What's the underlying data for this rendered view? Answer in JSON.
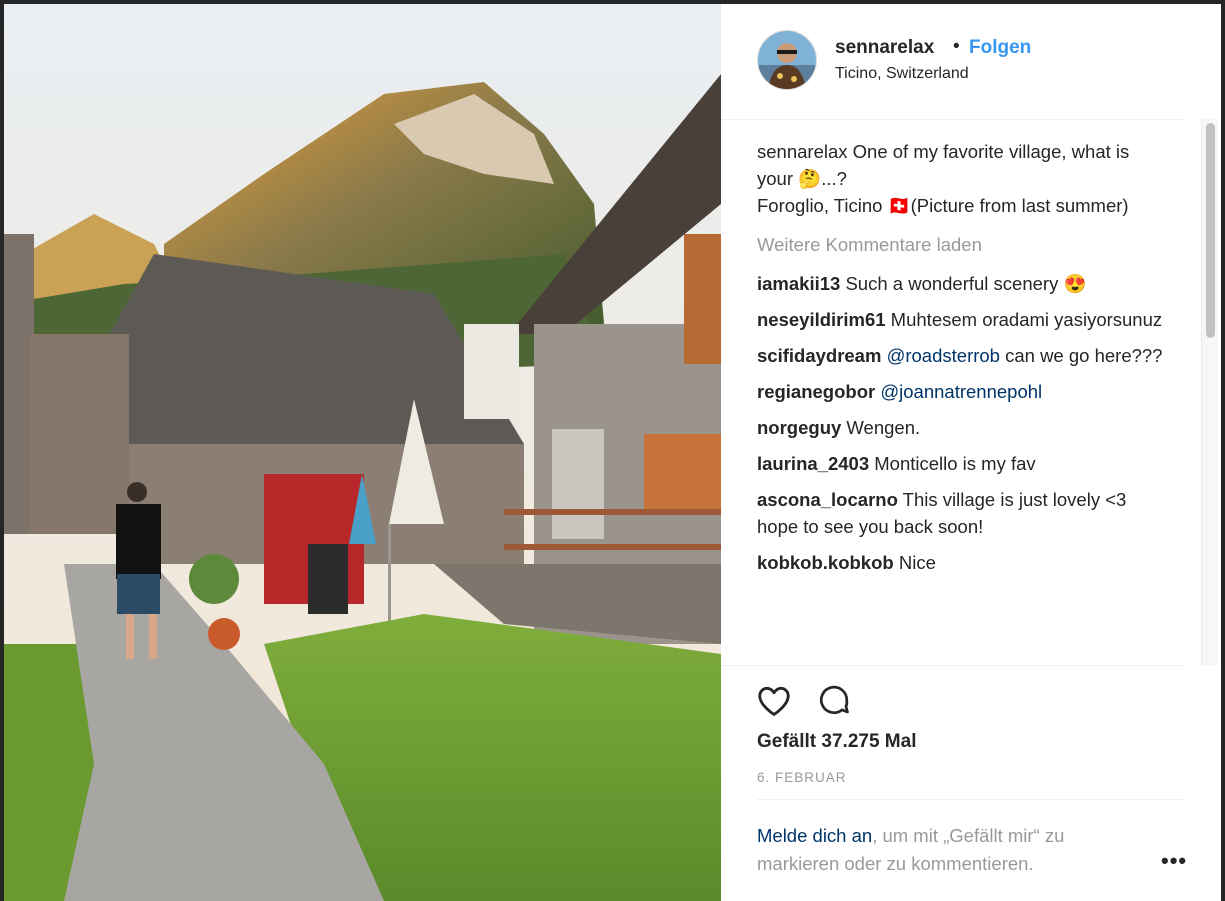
{
  "post": {
    "username": "sennarelax",
    "separator": "•",
    "follow_label": "Folgen",
    "location": "Ticino, Switzerland"
  },
  "caption": {
    "username": "sennarelax",
    "text_part1": " One of my favorite village, what is your ",
    "emoji_think": "🤔",
    "text_part2": "...?",
    "text_part3": "Foroglio, Ticino ",
    "flag": "🇨🇭",
    "text_part4": "(Picture from last summer)"
  },
  "load_more_label": "Weitere Kommentare laden",
  "comments": [
    {
      "user": "iamakii13",
      "text": " Such a wonderful scenery ",
      "emoji": "😍"
    },
    {
      "user": "neseyildirim61",
      "text": " Muhtesem oradami yasiyorsunuz"
    },
    {
      "user": "scifidaydream",
      "mention": "@roadsterrob",
      "text": " can we go here???"
    },
    {
      "user": "regianegobor",
      "mention": "@joannatrennepohl",
      "text": ""
    },
    {
      "user": "norgeguy",
      "text": " Wengen."
    },
    {
      "user": "laurina_2403",
      "text": " Monticello is my fav"
    },
    {
      "user": "ascona_locarno",
      "text": " This village is just lovely <3 hope to see you back soon!"
    },
    {
      "user": "kobkob.kobkob",
      "text": " Nice"
    }
  ],
  "actions": {
    "like_icon": "heart-icon",
    "comment_icon": "comment-icon"
  },
  "likes_text": "Gefällt 37.275 Mal",
  "date": "6. FEBRUAR",
  "login_prompt": {
    "link": "Melde dich an",
    "rest": ", um mit „Gefällt mir“ zu markieren oder zu kommentieren."
  },
  "more_options_label": "•••",
  "colors": {
    "link_blue": "#3897f0",
    "mention_blue": "#003569",
    "muted_gray": "#999999",
    "text_dark": "#262626"
  }
}
